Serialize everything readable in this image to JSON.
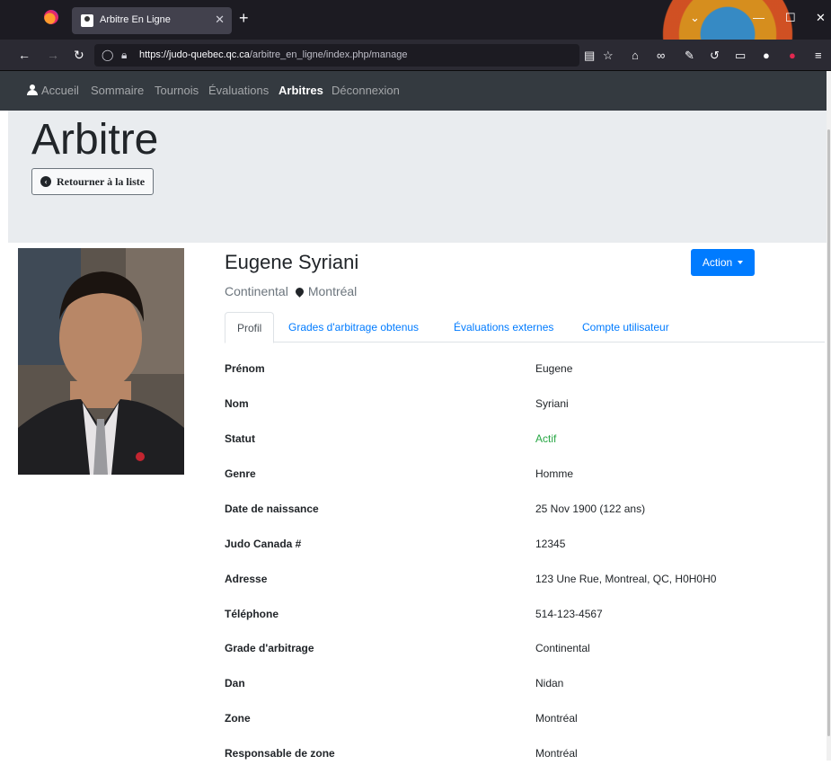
{
  "browser": {
    "tab_title": "Arbitre En Ligne",
    "new_tab": "+",
    "url_host": "https://judo-quebec.qc.ca",
    "url_path": "/arbitre_en_ligne/index.php/manage"
  },
  "sitenav": {
    "items": [
      "Accueil",
      "Sommaire",
      "Tournois",
      "Évaluations",
      "Arbitres",
      "Déconnexion"
    ],
    "active": "Arbitres"
  },
  "header": {
    "title": "Arbitre",
    "back_label": "Retourner à la liste"
  },
  "profile": {
    "name": "Eugene Syriani",
    "grade": "Continental",
    "location": "Montréal",
    "action_label": "Action",
    "tabs": [
      "Profil",
      "Grades d'arbitrage obtenus",
      "Évaluations externes",
      "Compte utilisateur"
    ],
    "fields": [
      {
        "label": "Prénom",
        "value": "Eugene"
      },
      {
        "label": "Nom",
        "value": "Syriani"
      },
      {
        "label": "Statut",
        "value": "Actif"
      },
      {
        "label": "Genre",
        "value": "Homme"
      },
      {
        "label": "Date de naissance",
        "value": "25 Nov 1900 (122 ans)"
      },
      {
        "label": "Judo Canada #",
        "value": "12345"
      },
      {
        "label": "Adresse",
        "value": "123 Une Rue, Montreal, QC, H0H0H0"
      },
      {
        "label": "Téléphone",
        "value": "514-123-4567"
      },
      {
        "label": "Grade d'arbitrage",
        "value": "Continental"
      },
      {
        "label": "Dan",
        "value": "Nidan"
      },
      {
        "label": "Zone",
        "value": "Montréal"
      },
      {
        "label": "Responsable de zone",
        "value": "Montréal"
      }
    ]
  },
  "colors": {
    "nav_bg": "#343a40",
    "jumbo_bg": "#e9ecef",
    "primary": "#007bff",
    "success": "#28a745"
  }
}
